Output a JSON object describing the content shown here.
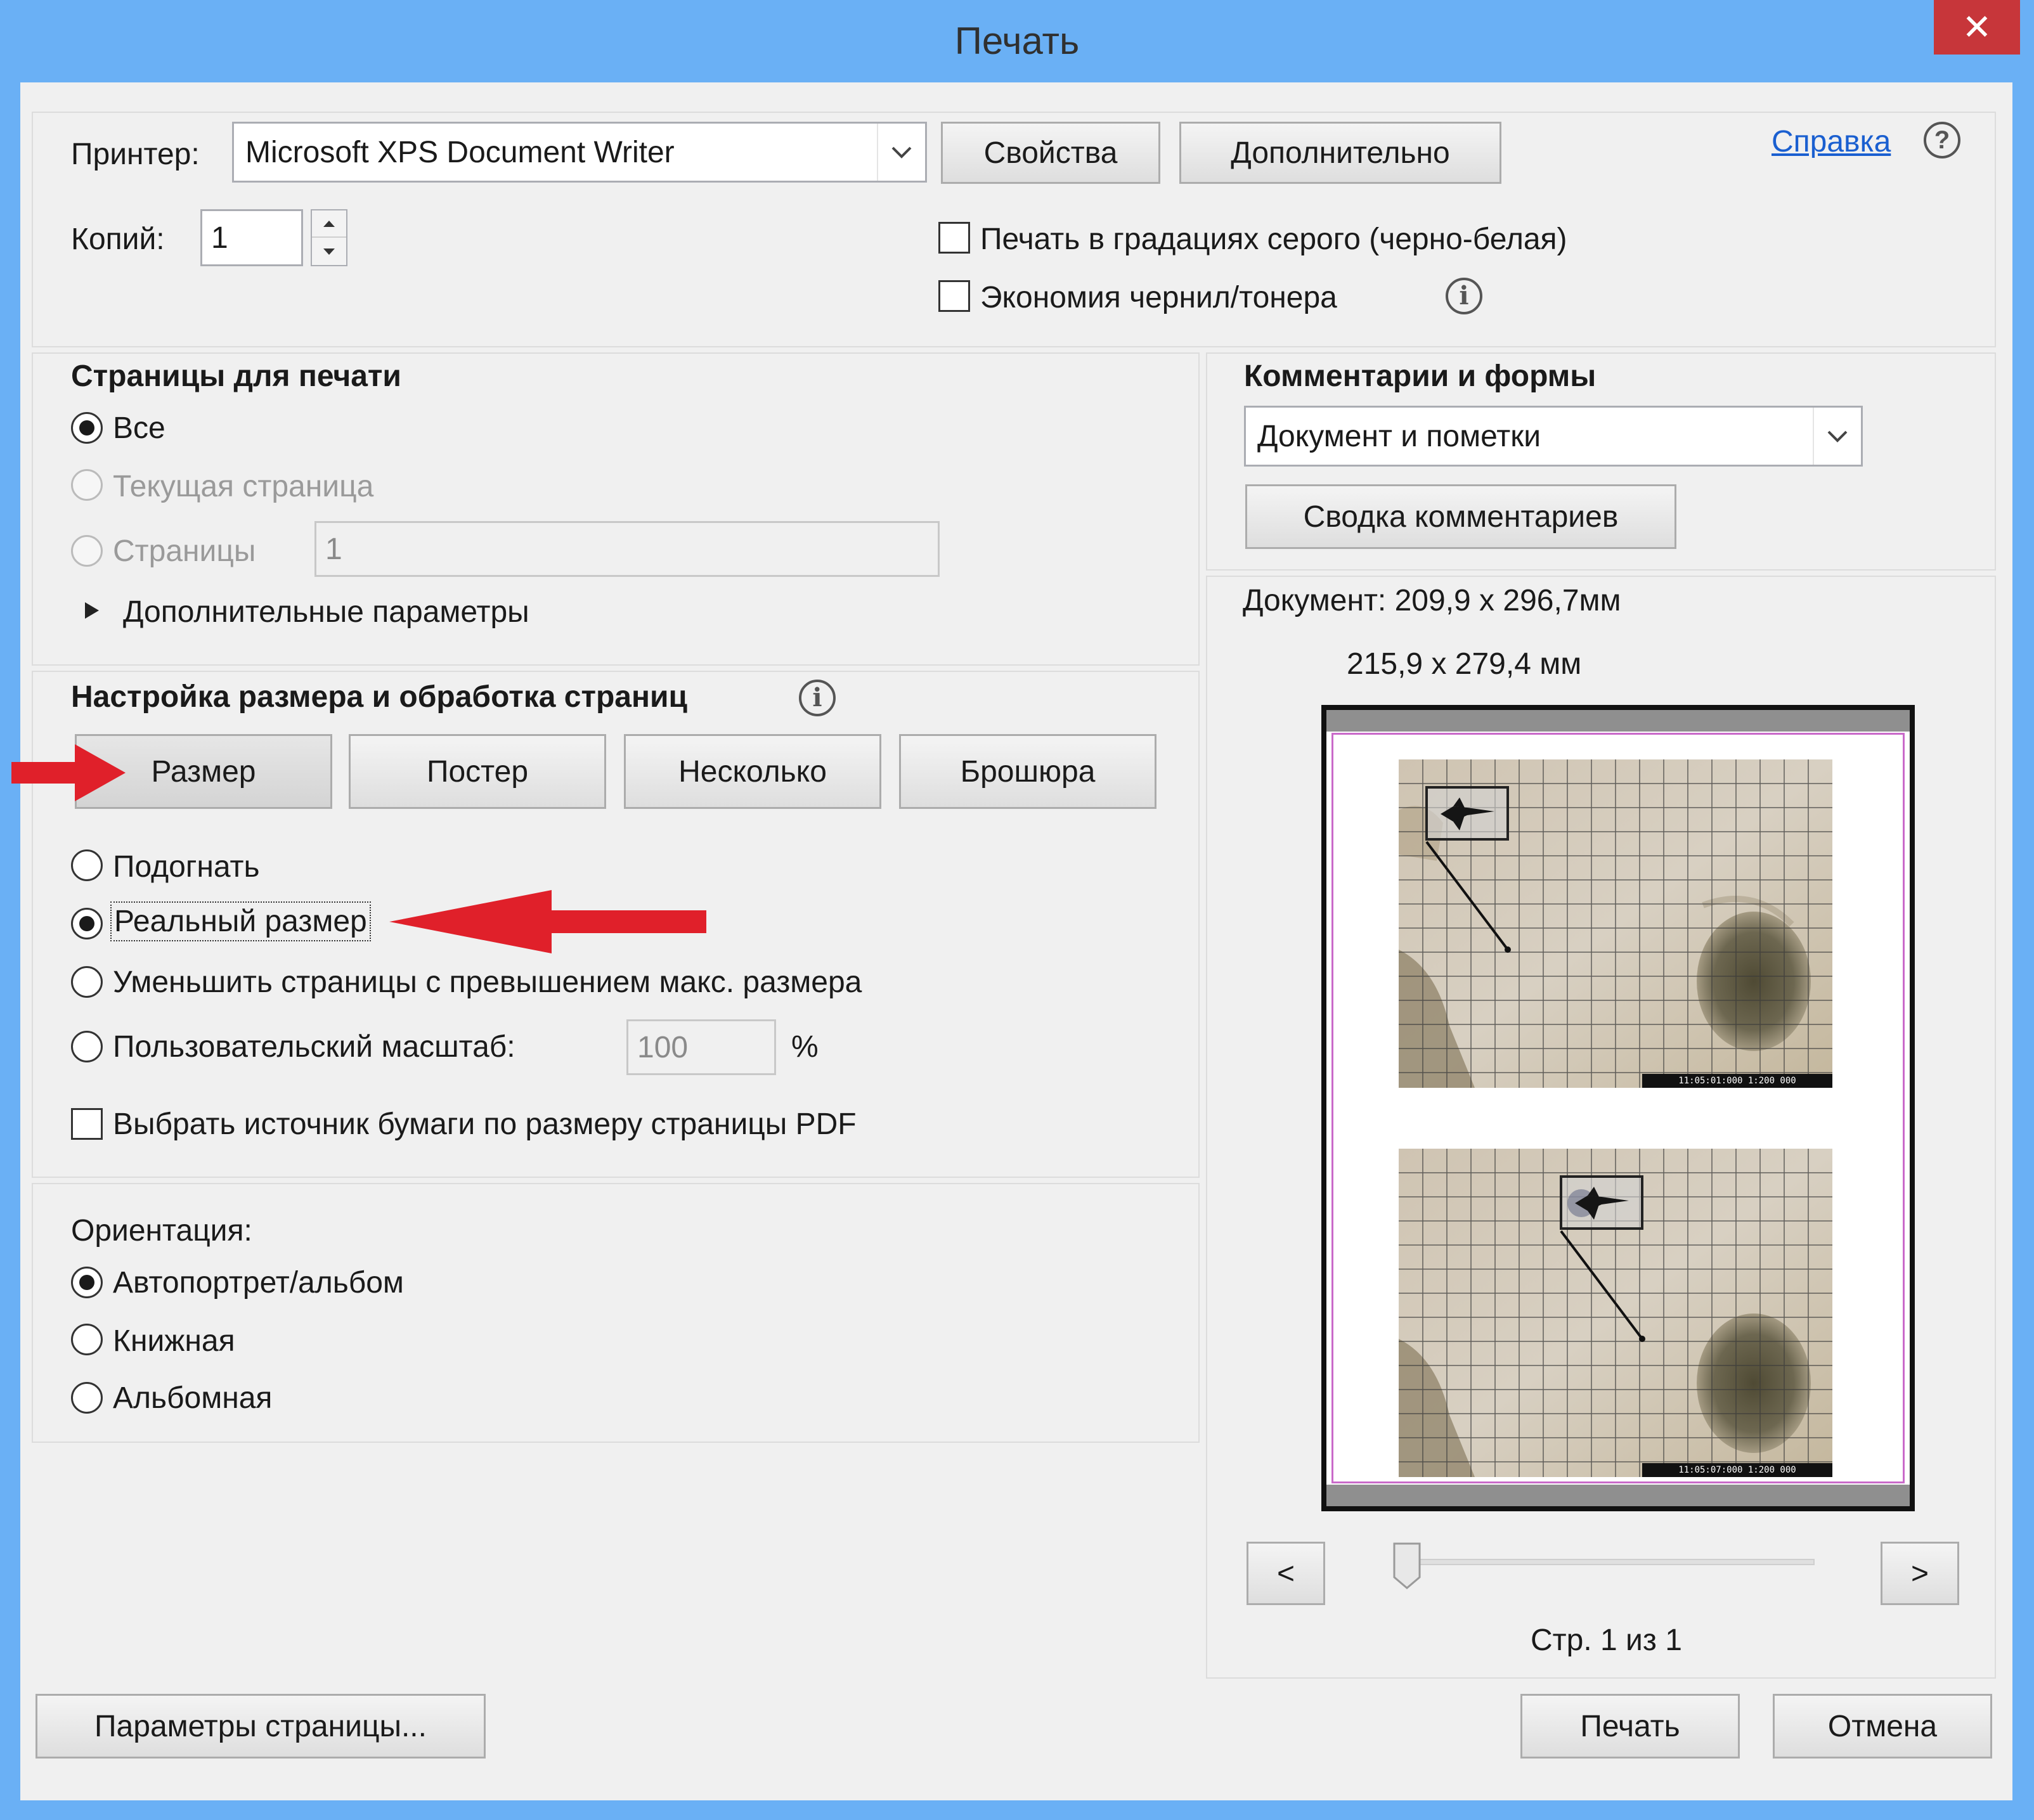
{
  "window": {
    "title": "Печать",
    "close_glyph": "✕"
  },
  "top": {
    "printer_label": "Принтер:",
    "printer_value": "Microsoft XPS Document Writer",
    "properties_button": "Свойства",
    "advanced_button": "Дополнительно",
    "help_link": "Справка",
    "help_icon": "?",
    "copies_label": "Копий:",
    "copies_value": "1",
    "grayscale_label": "Печать в градациях серого (черно-белая)",
    "grayscale_checked": false,
    "save_ink_label": "Экономия чернил/тонера",
    "save_ink_checked": false,
    "info_glyph": "i"
  },
  "pages": {
    "heading": "Страницы для печати",
    "all_label": "Все",
    "current_label": "Текущая страница",
    "pages_label": "Страницы",
    "pages_value": "1",
    "more_options_label": "Дополнительные параметры",
    "selected": "all"
  },
  "sizing": {
    "heading": "Настройка размера и обработка страниц",
    "tabs": [
      "Размер",
      "Постер",
      "Несколько",
      "Брошюра"
    ],
    "fit_label": "Подогнать",
    "actual_label": "Реальный размер",
    "shrink_label": "Уменьшить страницы с превышением макс. размера",
    "custom_label": "Пользовательский масштаб:",
    "custom_value": "100",
    "percent_sign": "%",
    "paper_source_label": "Выбрать источник бумаги по размеру страницы PDF",
    "paper_source_checked": false,
    "selected": "actual"
  },
  "orientation": {
    "heading": "Ориентация:",
    "auto_label": "Автопортрет/альбом",
    "portrait_label": "Книжная",
    "landscape_label": "Альбомная",
    "selected": "auto"
  },
  "comments": {
    "heading": "Комментарии и формы",
    "combo_value": "Документ и пометки",
    "summary_button": "Сводка комментариев"
  },
  "preview": {
    "document_size": "Документ: 209,9 x 296,7мм",
    "paper_size": "215,9 x 279,4 мм",
    "prev_button": "<",
    "next_button": ">",
    "page_status": "Стр. 1 из 1",
    "map_scale_text_1": "11:05:01:000 1:200 000",
    "map_scale_text_2": "11:05:07:000 1:200 000"
  },
  "bottom": {
    "page_setup_button": "Параметры страницы...",
    "print_button": "Печать",
    "cancel_button": "Отмена"
  },
  "colors": {
    "titlebar": "#6ab0f5",
    "close": "#c7363a",
    "annotation_arrow": "#e0202a",
    "link": "#1a5fd0"
  }
}
